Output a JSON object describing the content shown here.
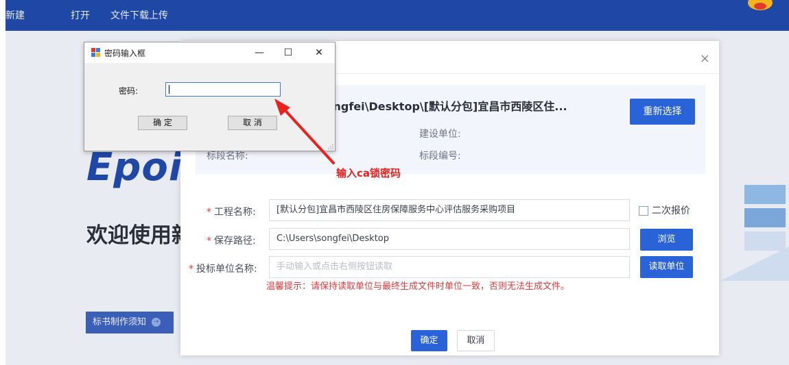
{
  "menubar": {
    "items": [
      "新建",
      "打开",
      "文件下载上传"
    ]
  },
  "background": {
    "logo_text": "Epoin",
    "welcome_text": "欢迎使用新",
    "guide_button": "标书制作须知"
  },
  "modal": {
    "file_path": "songfei\\Desktop\\[默认分包]宜昌市西陵区住...",
    "rechoose_button": "重新选择",
    "info": {
      "build_unit_label": "建设单位:",
      "section_name_label": "标段名称:",
      "section_code_label": "标段编号:"
    },
    "fields": {
      "project_name_label": "工程名称:",
      "project_name_value": "[默认分包]宜昌市西陵区住房保障服务中心评估服务采购项目",
      "second_quote_label": "二次报价",
      "save_path_label": "保存路径:",
      "save_path_value": "C:\\Users\\songfei\\Desktop",
      "browse_button": "浏览",
      "bidder_label": "投标单位名称:",
      "bidder_placeholder": "手动输入或点击右侧按钮读取",
      "read_unit_button": "读取单位",
      "required_mark": "*"
    },
    "tip": "温馨提示：请保持读取单位与最终生成文件时单位一致，否则无法生成文件。",
    "ok_button": "确定",
    "cancel_button": "取消"
  },
  "password_dialog": {
    "title": "密码输入框",
    "minimize": "—",
    "maximize": "☐",
    "close": "✕",
    "password_label": "密码:",
    "ok_button": "确 定",
    "cancel_button": "取 消"
  },
  "annotation": {
    "text": "输入ca锁密码",
    "color": "#e8221f"
  },
  "colors": {
    "menubar": "#1f47a6",
    "primary": "#2a63d8",
    "danger": "#e4393c"
  }
}
